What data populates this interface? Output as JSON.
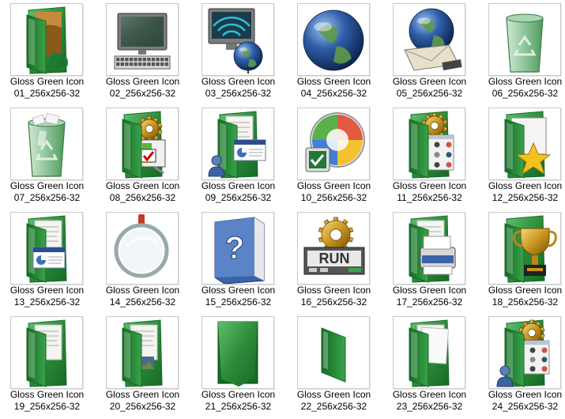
{
  "items": [
    {
      "line1": "Gloss Green Icon",
      "line2": "01_256x256-32",
      "icon": "folder-music-icon"
    },
    {
      "line1": "Gloss Green Icon",
      "line2": "02_256x256-32",
      "icon": "computer-icon"
    },
    {
      "line1": "Gloss Green Icon",
      "line2": "03_256x256-32",
      "icon": "network-globe-icon"
    },
    {
      "line1": "Gloss Green Icon",
      "line2": "04_256x256-32",
      "icon": "globe-icon"
    },
    {
      "line1": "Gloss Green Icon",
      "line2": "05_256x256-32",
      "icon": "globe-mail-icon"
    },
    {
      "line1": "Gloss Green Icon",
      "line2": "06_256x256-32",
      "icon": "recycle-bin-empty-icon"
    },
    {
      "line1": "Gloss Green Icon",
      "line2": "07_256x256-32",
      "icon": "recycle-bin-full-icon"
    },
    {
      "line1": "Gloss Green Icon",
      "line2": "08_256x256-32",
      "icon": "control-panel-folder-icon"
    },
    {
      "line1": "Gloss Green Icon",
      "line2": "09_256x256-32",
      "icon": "presentation-user-folder-icon"
    },
    {
      "line1": "Gloss Green Icon",
      "line2": "10_256x256-32",
      "icon": "windows-checkmark-icon"
    },
    {
      "line1": "Gloss Green Icon",
      "line2": "11_256x256-32",
      "icon": "programs-folder-icon"
    },
    {
      "line1": "Gloss Green Icon",
      "line2": "12_256x256-32",
      "icon": "favorites-folder-icon"
    },
    {
      "line1": "Gloss Green Icon",
      "line2": "13_256x256-32",
      "icon": "presentation-folder-icon"
    },
    {
      "line1": "Gloss Green Icon",
      "line2": "14_256x256-32",
      "icon": "magnifier-icon"
    },
    {
      "line1": "Gloss Green Icon",
      "line2": "15_256x256-32",
      "icon": "help-book-icon"
    },
    {
      "line1": "Gloss Green Icon",
      "line2": "16_256x256-32",
      "icon": "run-gear-icon"
    },
    {
      "line1": "Gloss Green Icon",
      "line2": "17_256x256-32",
      "icon": "printer-folder-icon"
    },
    {
      "line1": "Gloss Green Icon",
      "line2": "18_256x256-32",
      "icon": "trophy-folder-icon"
    },
    {
      "line1": "Gloss Green Icon",
      "line2": "19_256x256-32",
      "icon": "folder-pages-icon"
    },
    {
      "line1": "Gloss Green Icon",
      "line2": "20_256x256-32",
      "icon": "folder-picture-icon"
    },
    {
      "line1": "Gloss Green Icon",
      "line2": "21_256x256-32",
      "icon": "folder-closed-icon"
    },
    {
      "line1": "Gloss Green Icon",
      "line2": "22_256x256-32",
      "icon": "folder-open-empty-icon"
    },
    {
      "line1": "Gloss Green Icon",
      "line2": "23_256x256-32",
      "icon": "folder-documents-icon"
    },
    {
      "line1": "Gloss Green Icon",
      "line2": "24_256x256-32",
      "icon": "user-programs-folder-icon"
    }
  ],
  "run_label": "RUN",
  "colors": {
    "folder_green": "#2e8b3a",
    "folder_dark": "#146b24",
    "globe_blue": "#2f5fa8"
  }
}
